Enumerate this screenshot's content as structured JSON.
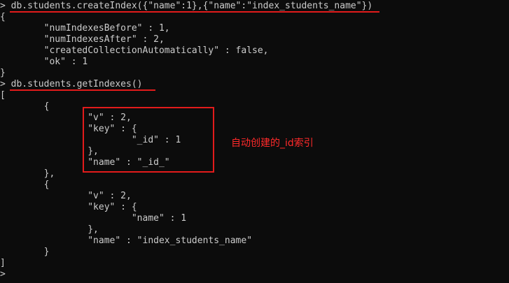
{
  "terminal": {
    "prompt_symbol": ">",
    "lines": [
      "> db.students.createIndex({\"name\":1},{\"name\":\"index_students_name\"})",
      "{",
      "        \"numIndexesBefore\" : 1,",
      "        \"numIndexesAfter\" : 2,",
      "        \"createdCollectionAutomatically\" : false,",
      "        \"ok\" : 1",
      "}",
      "> db.students.getIndexes()",
      "[",
      "        {",
      "                \"v\" : 2,",
      "                \"key\" : {",
      "                        \"_id\" : 1",
      "                },",
      "                \"name\" : \"_id_\"",
      "        },",
      "        {",
      "                \"v\" : 2,",
      "                \"key\" : {",
      "                        \"name\" : 1",
      "                },",
      "                \"name\" : \"index_students_name\"",
      "        }",
      "]",
      ">"
    ]
  },
  "annotation": {
    "label": "自动创建的_id索引"
  },
  "colors": {
    "background": "#0c0c0c",
    "text": "#cccccc",
    "highlight": "#e21b1b"
  }
}
